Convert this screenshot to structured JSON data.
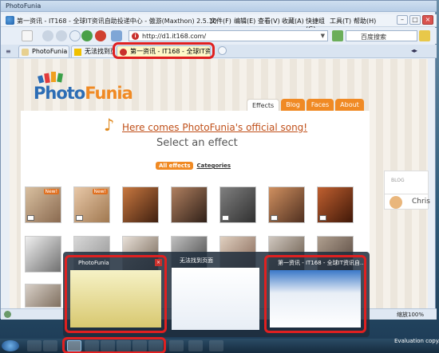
{
  "window": {
    "title": "PhotoFunia",
    "app_title": "第一资讯 - IT168 - 全球IT资讯自助投递中心 - 傲游(Maxthon) 2.5.10",
    "menus": [
      "文件(F)",
      "编辑(E)",
      "查看(V)",
      "收藏(A)",
      "快捷组(G)",
      "工具(T)",
      "帮助(H)"
    ],
    "controls": [
      "–",
      "□",
      "×"
    ]
  },
  "navbar": {
    "address": "http://d1.it168.com/",
    "search_placeholder": "百度搜索"
  },
  "tabs": [
    {
      "label": "PhotoFunia",
      "active": false
    },
    {
      "label": "无法找到页面",
      "active": false
    },
    {
      "label": "第一资讯 - IT168 - 全球IT资...",
      "active": true
    }
  ],
  "site": {
    "logo_a": "Photo",
    "logo_b": "Funia",
    "nav": [
      {
        "label": "Effects",
        "selected": true
      },
      {
        "label": "Blog",
        "selected": false
      },
      {
        "label": "Faces",
        "selected": false
      },
      {
        "label": "About",
        "selected": false
      }
    ],
    "song_link": "Here comes PhotoFunia's official song!",
    "select_heading": "Select an effect",
    "filter_all": "All effects",
    "filter_categories": "Categories",
    "new_badge": "New!",
    "side_label": "BLOG",
    "side_name": "Chris"
  },
  "previews": [
    {
      "title": "PhotoFunia",
      "highlight": true
    },
    {
      "title": "无法找到页面",
      "highlight": false
    },
    {
      "title": "第一资讯 - IT168 - 全球IT资讯自...",
      "highlight": true
    }
  ],
  "statusbar": {
    "zoom": "缩放100%"
  },
  "taskbar": {
    "evaluation": "Evaluation copy. Bu"
  },
  "colors": {
    "accent": "#f08a24",
    "link": "#c0501a",
    "highlight": "#e02020"
  }
}
